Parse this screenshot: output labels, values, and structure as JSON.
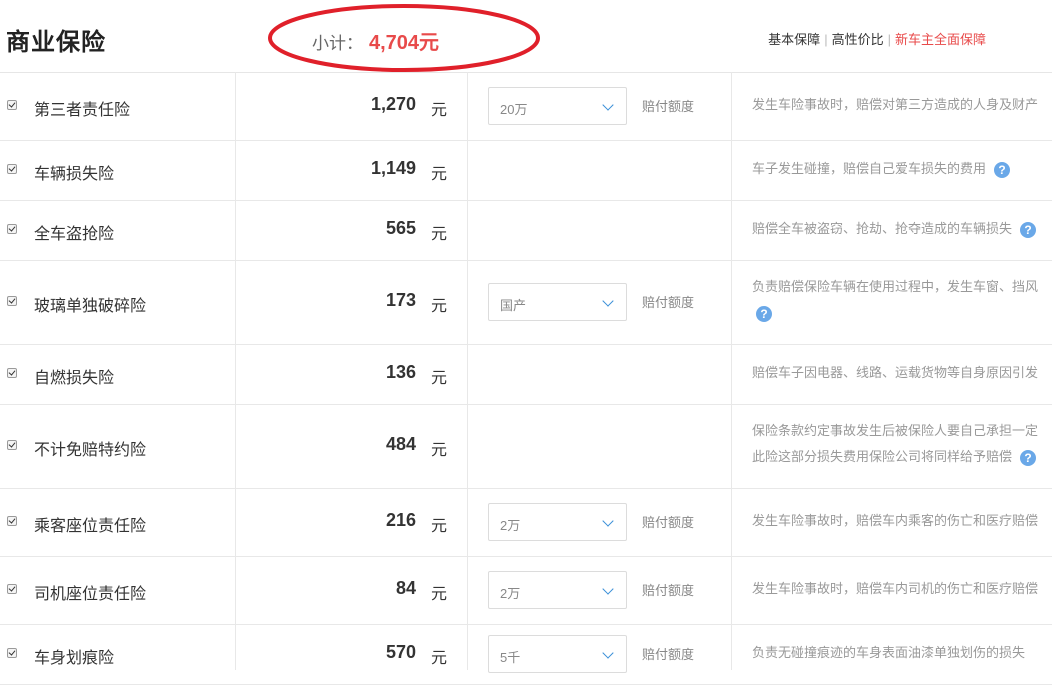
{
  "header": {
    "title": "商业保险",
    "subtotal_label": "小计：",
    "subtotal_value": "4,704元",
    "plans": [
      "基本保障",
      "高性价比",
      "新车主全面保障"
    ],
    "active_plan": "新车主全面保障",
    "highlight_color": "#e0202a"
  },
  "rows": [
    {
      "name": "第三者责任险",
      "price": "1,270",
      "unit": "元",
      "select": "20万",
      "pay_label": "赔付额度",
      "desc": "发生车险事故时，赔偿对第三方造成的人身及财产",
      "desc2": "",
      "help": false
    },
    {
      "name": "车辆损失险",
      "price": "1,149",
      "unit": "元",
      "select": null,
      "pay_label": "",
      "desc": "车子发生碰撞，赔偿自己爱车损失的费用",
      "desc2": "",
      "help": true
    },
    {
      "name": "全车盗抢险",
      "price": "565",
      "unit": "元",
      "select": null,
      "pay_label": "",
      "desc": "赔偿全车被盗窃、抢劫、抢夺造成的车辆损失",
      "desc2": "",
      "help": true
    },
    {
      "name": "玻璃单独破碎险",
      "price": "173",
      "unit": "元",
      "select": "国产",
      "pay_label": "赔付额度",
      "desc": "负责赔偿保险车辆在使用过程中，发生车窗、挡风",
      "desc2": "",
      "help": true
    },
    {
      "name": "自燃损失险",
      "price": "136",
      "unit": "元",
      "select": null,
      "pay_label": "",
      "desc": "赔偿车子因电器、线路、运载货物等自身原因引发",
      "desc2": "",
      "help": false
    },
    {
      "name": "不计免赔特约险",
      "price": "484",
      "unit": "元",
      "select": null,
      "pay_label": "",
      "desc": "保险条款约定事故发生后被保险人要自己承担一定",
      "desc2": "此险这部分损失费用保险公司将同样给予赔偿",
      "help": true
    },
    {
      "name": "乘客座位责任险",
      "price": "216",
      "unit": "元",
      "select": "2万",
      "pay_label": "赔付额度",
      "desc": "发生车险事故时，赔偿车内乘客的伤亡和医疗赔偿",
      "desc2": "",
      "help": false
    },
    {
      "name": "司机座位责任险",
      "price": "84",
      "unit": "元",
      "select": "2万",
      "pay_label": "赔付额度",
      "desc": "发生车险事故时，赔偿车内司机的伤亡和医疗赔偿",
      "desc2": "",
      "help": false
    },
    {
      "name": "车身划痕险",
      "price": "570",
      "unit": "元",
      "select": "5千",
      "pay_label": "赔付额度",
      "desc": "负责无碰撞痕迹的车身表面油漆单独划伤的损失",
      "desc2": "",
      "help": false
    }
  ],
  "icons": {
    "checkbox": "checkbox-checked-icon",
    "chevron": "chevron-down-icon",
    "help": "question-circle-icon"
  }
}
